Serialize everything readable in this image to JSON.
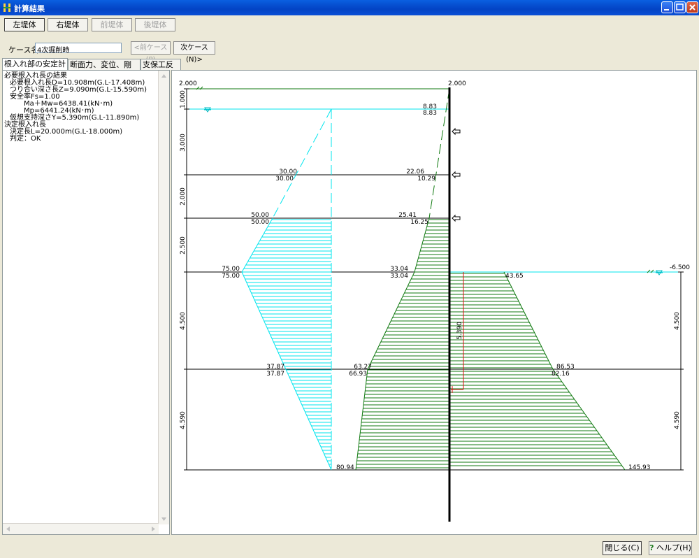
{
  "window": {
    "title": "計算結果"
  },
  "toolbar": {
    "buttons": [
      {
        "label": "左堤体",
        "active": true,
        "enabled": true
      },
      {
        "label": "右堤体",
        "active": false,
        "enabled": true
      },
      {
        "label": "前堤体",
        "active": false,
        "enabled": false
      },
      {
        "label": "後堤体",
        "active": false,
        "enabled": false
      }
    ]
  },
  "case": {
    "label": "ケース名",
    "value": "4次掘削時",
    "prev_label": "<前ケース(P)",
    "next_label": "次ケース(N)>"
  },
  "tabs": [
    {
      "label": "根入れ部の安定計算",
      "active": true
    },
    {
      "label": "断面力、変位、剛性検討",
      "active": false
    },
    {
      "label": "支保工反力",
      "active": false
    }
  ],
  "results": [
    "必要根入れ長の結果",
    "必要根入れ長D=10.908m(G.L-17.408m)",
    "つり合い深さ長Z=9.090m(G.L-15.590m)",
    "安全率Fs=1.00",
    "Ma＋Mw=6438.41(kN･m)",
    "Mp=6441.24(kN･m)",
    "仮想支持深さY=5.390m(G.L-11.890m)",
    "決定根入れ長",
    "決定長L=20.000m(G.L-18.000m)",
    "判定：OK"
  ],
  "diagram": {
    "top_left_label": "2.000",
    "top_wall_label": "2.000",
    "right_level_label": "-6.500",
    "left_dims": [
      "1.000",
      "3.000",
      "2.000",
      "2.500",
      "4.500",
      "4.590"
    ],
    "right_dims": [
      "4.500",
      "4.590"
    ],
    "y_marker": "5.390",
    "left_pressures": [
      {
        "a": "30.00",
        "b": "30.00"
      },
      {
        "a": "50.00",
        "b": "50.00"
      },
      {
        "a": "75.00",
        "b": "75.00"
      },
      {
        "a": "37.87",
        "b": "37.87"
      },
      {
        "a": "80.94"
      }
    ],
    "mid_pressures": [
      {
        "a": "8.83",
        "b": "8.83"
      },
      {
        "a": "22.06",
        "b": "10.29"
      },
      {
        "a": "25.41",
        "b": "16.25"
      },
      {
        "a": "33.04",
        "b": "33.04"
      },
      {
        "a": "63.27",
        "b": "66.93"
      }
    ],
    "right_pressures": [
      {
        "a": "43.65"
      },
      {
        "a": "86.53",
        "b": "82.16"
      },
      {
        "a": "145.93"
      }
    ],
    "colors": {
      "water": "#00e5ee",
      "soil": "#117a11",
      "wall": "#000000",
      "marker": "#e01010"
    }
  },
  "footer": {
    "close_label": "閉じる(C)",
    "help_label": "ヘルプ(H)"
  }
}
